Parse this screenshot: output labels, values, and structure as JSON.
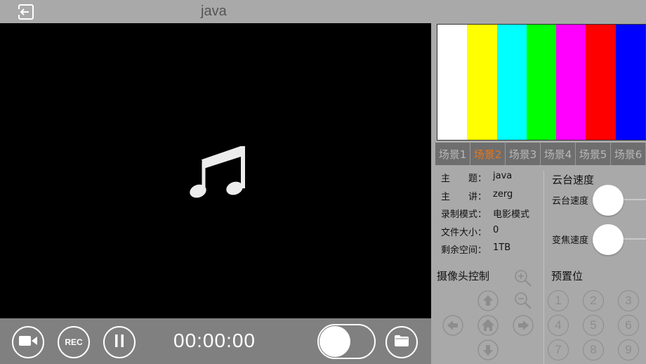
{
  "header": {
    "title": "java",
    "exit_icon": "exit-icon"
  },
  "video": {
    "placeholder_icon": "music-note-icon"
  },
  "controls": {
    "camera_icon": "video-camera-icon",
    "rec_label": "REC",
    "pause_icon": "pause-icon",
    "timer": "00:00:00",
    "toggle_on": false,
    "folder_icon": "folder-icon"
  },
  "colorbars": [
    "#ffffff",
    "#ffff00",
    "#00ffff",
    "#00ff00",
    "#ff00ff",
    "#ff0000",
    "#0000ff"
  ],
  "scenes": [
    {
      "label": "场景1",
      "active": false
    },
    {
      "label": "场景2",
      "active": true
    },
    {
      "label": "场景3",
      "active": false
    },
    {
      "label": "场景4",
      "active": false
    },
    {
      "label": "场景5",
      "active": false
    },
    {
      "label": "场景6",
      "active": false
    }
  ],
  "scene_active_color": "#e8771b",
  "info": [
    {
      "key": "主　　题：",
      "value": "java"
    },
    {
      "key": "主　　讲：",
      "value": "zerg"
    },
    {
      "key": "录制模式：",
      "value": "电影模式"
    },
    {
      "key": "文件大小：",
      "value": "0"
    },
    {
      "key": "剩余空间：",
      "value": "1TB"
    }
  ],
  "ptz": {
    "title": "云台速度",
    "pan_label": "云台速度",
    "pan_value": 0.05,
    "zoom_label": "变焦速度",
    "zoom_value": 0.05,
    "accent": "#1a7ee0"
  },
  "camera_control": {
    "title": "摄像头控制",
    "icons": [
      "zoom-in-icon",
      "zoom-out-icon",
      "arrow-up-icon",
      "arrow-left-icon",
      "home-icon",
      "arrow-right-icon",
      "arrow-down-icon"
    ]
  },
  "presets": {
    "title": "预置位",
    "items": [
      "1",
      "2",
      "3",
      "4",
      "5",
      "6",
      "7",
      "8",
      "9"
    ]
  }
}
